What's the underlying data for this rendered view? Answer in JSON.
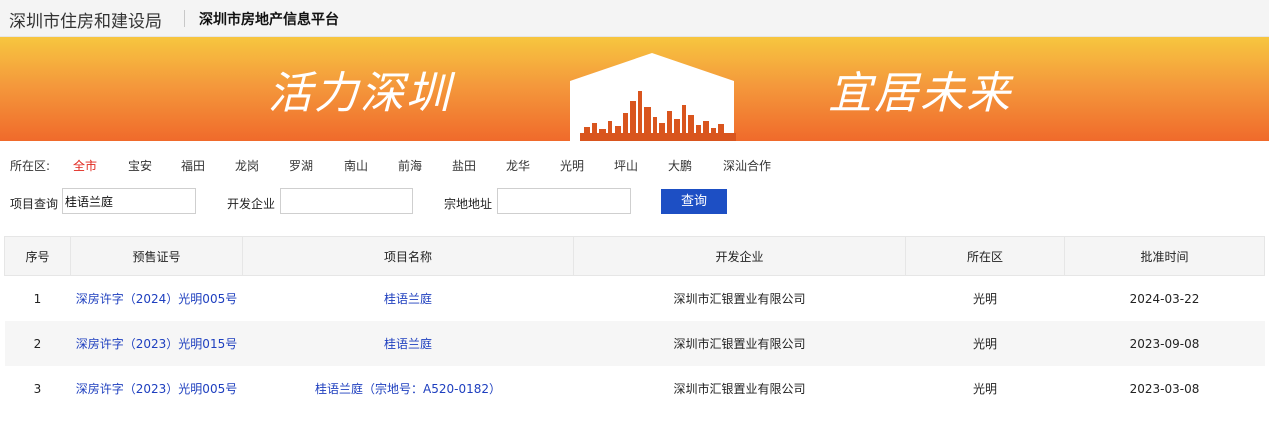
{
  "header": {
    "org_name": "深圳市住房和建设局",
    "platform_name": "深圳市房地产信息平台"
  },
  "banner": {
    "slogan_left": "活力深圳",
    "slogan_right": "宜居未来"
  },
  "colors": {
    "banner_top": "#f7c63f",
    "banner_bottom": "#f06a2b",
    "active_district": "#e0261c",
    "link": "#1e3fbf",
    "query_button": "#1d4fc4"
  },
  "filters": {
    "district_label": "所在区:",
    "districts": [
      "全市",
      "宝安",
      "福田",
      "龙岗",
      "罗湖",
      "南山",
      "前海",
      "盐田",
      "龙华",
      "光明",
      "坪山",
      "大鹏",
      "深汕合作"
    ],
    "active_district": "全市"
  },
  "search": {
    "project_label": "项目查询",
    "project_value": "桂语兰庭",
    "developer_label": "开发企业",
    "developer_value": "",
    "address_label": "宗地地址",
    "address_value": "",
    "query_label": "查询"
  },
  "table": {
    "headers": [
      "序号",
      "预售证号",
      "项目名称",
      "开发企业",
      "所在区",
      "批准时间"
    ],
    "rows": [
      {
        "no": "1",
        "permit": "深房许字（2024）光明005号",
        "project": "桂语兰庭",
        "developer": "深圳市汇银置业有限公司",
        "district": "光明",
        "date": "2024-03-22"
      },
      {
        "no": "2",
        "permit": "深房许字（2023）光明015号",
        "project": "桂语兰庭",
        "developer": "深圳市汇银置业有限公司",
        "district": "光明",
        "date": "2023-09-08"
      },
      {
        "no": "3",
        "permit": "深房许字（2023）光明005号",
        "project": "桂语兰庭（宗地号：A520-0182）",
        "developer": "深圳市汇银置业有限公司",
        "district": "光明",
        "date": "2023-03-08"
      }
    ]
  }
}
